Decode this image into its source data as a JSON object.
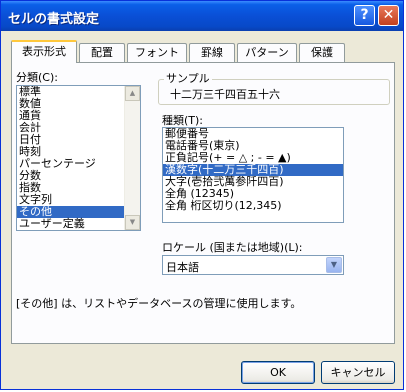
{
  "window": {
    "title": "セルの書式設定",
    "help_glyph": "?",
    "close_glyph": "✕"
  },
  "tabs": [
    {
      "label": "表示形式",
      "active": true
    },
    {
      "label": "配置"
    },
    {
      "label": "フォント"
    },
    {
      "label": "罫線"
    },
    {
      "label": "パターン"
    },
    {
      "label": "保護"
    }
  ],
  "category": {
    "label": "分類(C):",
    "items": [
      "標準",
      "数値",
      "通貨",
      "会計",
      "日付",
      "時刻",
      "パーセンテージ",
      "分数",
      "指数",
      "文字列",
      "その他",
      "ユーザー定義"
    ],
    "selected_index": 10
  },
  "sample": {
    "label": "サンプル",
    "value": "十二万三千四百五十六"
  },
  "type": {
    "label": "種類(T):",
    "items": [
      "郵便番号",
      "電話番号(東京)",
      "正負記号(+ = △ ; - = ▲)",
      "漢数字(十二万三千四百)",
      "大字(壱拾弐萬参阡四百)",
      "全角 (12345)",
      "全角 桁区切り(12,345)"
    ],
    "selected_index": 3
  },
  "locale": {
    "label": "ロケール (国または地域)(L):",
    "value": "日本語"
  },
  "description": "[その他] は、リストやデータベースの管理に使用します。",
  "buttons": {
    "ok": "OK",
    "cancel": "キャンセル"
  },
  "colors": {
    "title_blue": "#0a4fd6",
    "selection": "#316ac5",
    "tab_highlight": "#ffc83c"
  }
}
